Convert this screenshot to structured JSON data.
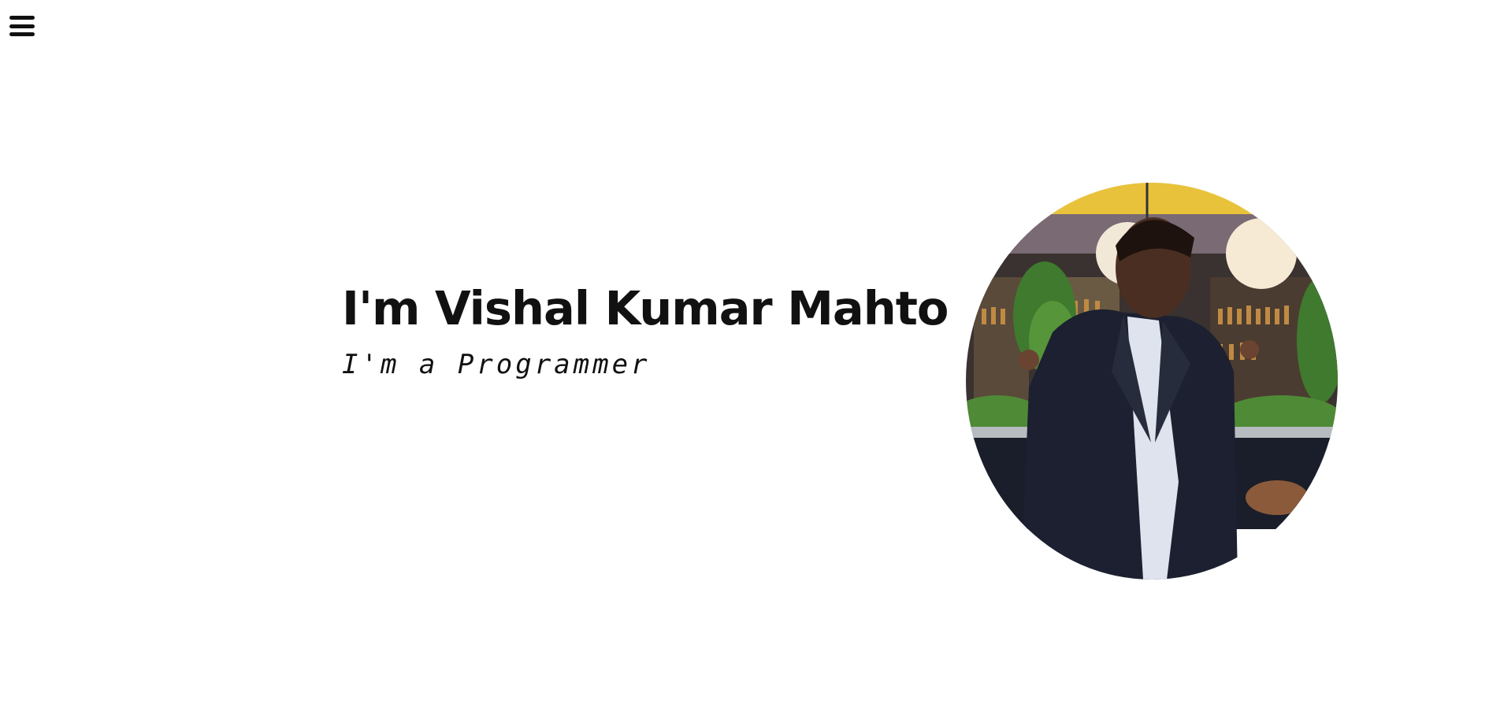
{
  "nav": {
    "menu_icon": "hamburger-menu-icon"
  },
  "hero": {
    "title": "I'm Vishal Kumar Mahto",
    "subtitle": "I'm a Programmer"
  },
  "profile_photo": {
    "shape": "circle"
  },
  "colors": {
    "background": "#ffffff",
    "text": "#111111"
  }
}
